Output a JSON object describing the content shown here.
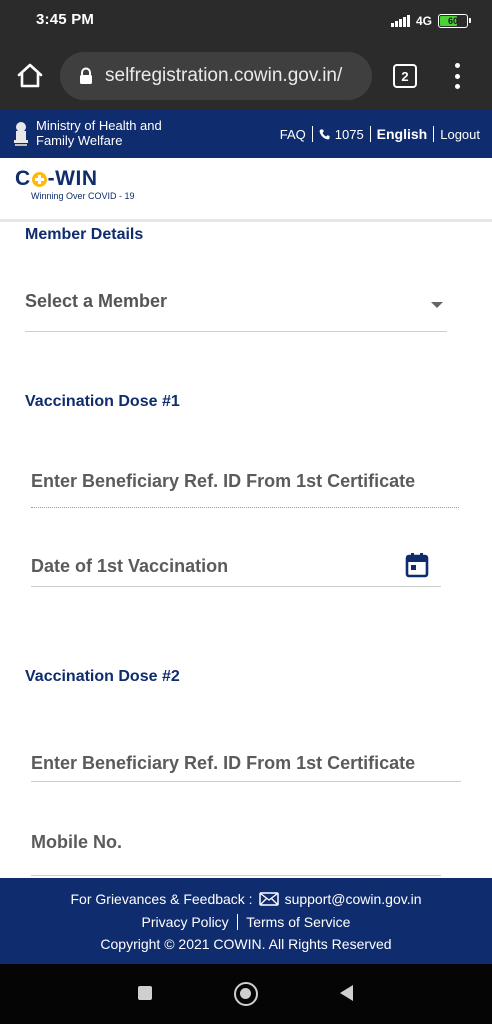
{
  "status_bar": {
    "time": "3:45 PM",
    "network": "4G",
    "battery": "60",
    "battery_level": 0.6
  },
  "browser": {
    "url": "selfregistration.cowin.gov.in/",
    "tab_count": "2"
  },
  "gov_header": {
    "ministry_line1": "Ministry of Health and",
    "ministry_line2": "Family Welfare",
    "faq": "FAQ",
    "helpline": "1075",
    "language": "English",
    "logout": "Logout"
  },
  "logo": {
    "brand_pre": "C",
    "brand_post": "-WIN",
    "tagline": "Winning Over COVID - 19",
    "accent_color": "#fdb913"
  },
  "form": {
    "member_section_title": "Member Details",
    "member_select_placeholder": "Select a Member",
    "dose1_title": "Vaccination Dose #1",
    "dose1_ref_placeholder": "Enter Beneficiary Ref. ID From 1st Certificate",
    "dose1_date_placeholder": "Date of 1st Vaccination",
    "dose2_title": "Vaccination Dose #2",
    "dose2_ref_placeholder": "Enter Beneficiary Ref. ID From 1st Certificate",
    "mobile_placeholder": "Mobile No."
  },
  "footer": {
    "grievance_label": "For Grievances & Feedback :",
    "email": "support@cowin.gov.in",
    "privacy": "Privacy Policy",
    "terms": "Terms of Service",
    "copyright": "Copyright © 2021 COWIN. All Rights Reserved"
  },
  "colors": {
    "primary": "#0f2c6e",
    "chrome_dark": "#2b2b2b"
  }
}
